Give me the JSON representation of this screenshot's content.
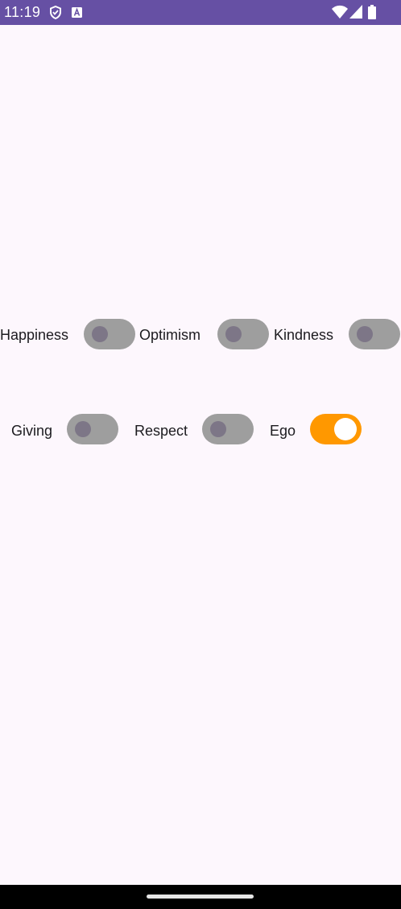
{
  "status_bar": {
    "time": "11:19",
    "color": "#6650a4",
    "icons": [
      "shield-icon",
      "text-a-icon",
      "wifi-icon",
      "signal-icon",
      "battery-icon"
    ]
  },
  "toggles": [
    {
      "label": "Happiness",
      "checked": false
    },
    {
      "label": "Optimism",
      "checked": false
    },
    {
      "label": "Kindness",
      "checked": false
    },
    {
      "label": "Giving",
      "checked": false
    },
    {
      "label": "Respect",
      "checked": false
    },
    {
      "label": "Ego",
      "checked": true
    }
  ],
  "colors": {
    "background": "#fdf7fd",
    "track_off": "#9e9e9e",
    "thumb_off": "#7d7687",
    "track_on": "#ff9800",
    "thumb_on": "#ffffff"
  }
}
